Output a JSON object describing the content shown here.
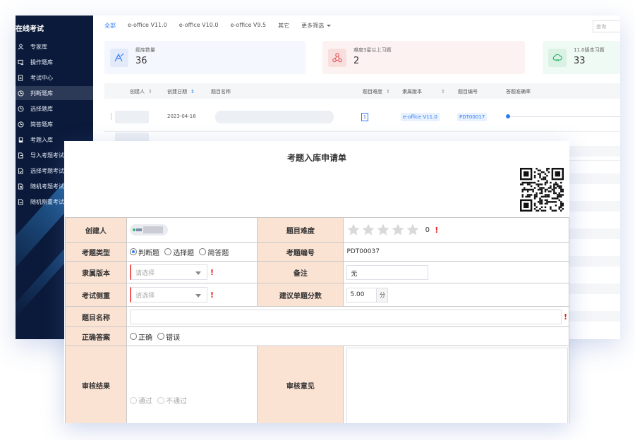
{
  "sidebar": {
    "title": "在线考试",
    "items": [
      {
        "label": "专家库",
        "icon": "user-icon"
      },
      {
        "label": "操作题库",
        "icon": "laptop-icon"
      },
      {
        "label": "考试中心",
        "icon": "document-icon"
      },
      {
        "label": "判断题库",
        "icon": "clock-icon",
        "active": true
      },
      {
        "label": "选择题库",
        "icon": "clock-icon"
      },
      {
        "label": "简答题库",
        "icon": "clock-icon"
      },
      {
        "label": "考题入库",
        "icon": "book-icon"
      },
      {
        "label": "导入考题考试",
        "icon": "file-import-icon"
      },
      {
        "label": "选择考题考试",
        "icon": "file-check-icon"
      },
      {
        "label": "随机考题考试",
        "icon": "file-random-icon"
      },
      {
        "label": "随机侧重考试",
        "icon": "file-focus-icon"
      }
    ]
  },
  "tabs": [
    {
      "label": "全部",
      "active": true
    },
    {
      "label": "e-office V11.0"
    },
    {
      "label": "e-office V10.0"
    },
    {
      "label": "e-office V9.5"
    },
    {
      "label": "其它"
    },
    {
      "label": "更多筛选",
      "dropdown": true
    }
  ],
  "search": {
    "placeholder": "查询"
  },
  "stats": [
    {
      "label": "题库数量",
      "value": "36",
      "color": "#2f7bf5",
      "bg": "#eef3fd",
      "icon": "pen-icon"
    },
    {
      "label": "难度3星以上习题",
      "value": "2",
      "color": "#e85a5a",
      "bg": "#fdf0f0",
      "icon": "network-icon"
    },
    {
      "label": "11.0版本习题",
      "value": "33",
      "color": "#29b36a",
      "bg": "#eef9f2",
      "icon": "cloud-icon"
    }
  ],
  "table": {
    "headers": {
      "creator": "创建人",
      "created_date": "创建日期",
      "name": "题目名称",
      "difficulty": "题目难度",
      "version": "隶属版本",
      "code": "题目编号",
      "accuracy": "答题准确率"
    },
    "rows": [
      {
        "date": "2023-04-16",
        "difficulty": "1",
        "version": "e-office V11.0",
        "code": "PDT00017",
        "accuracy": 0.0
      }
    ]
  },
  "form": {
    "title": "考题入库申请单",
    "labels": {
      "creator": "创建人",
      "difficulty": "题目难度",
      "type": "考题类型",
      "code": "考题编号",
      "version": "隶属版本",
      "remark": "备注",
      "focus": "考试侧重",
      "score": "建议单题分数",
      "name": "题目名称",
      "answer": "正确答案",
      "audit_result": "审核结果",
      "audit_opinion": "审核意见"
    },
    "type_options": [
      "判断题",
      "选择题",
      "简答题"
    ],
    "type_selected": "判断题",
    "difficulty_value": "0",
    "stars_total": 5,
    "code_value": "PDT00037",
    "version_placeholder": "请选择",
    "focus_placeholder": "请选择",
    "remark_value": "无",
    "score_value": "5.00",
    "score_unit": "分",
    "answer_options": [
      "正确",
      "错误"
    ],
    "audit_options": [
      "通过",
      "不通过"
    ],
    "required_mark": "!"
  }
}
